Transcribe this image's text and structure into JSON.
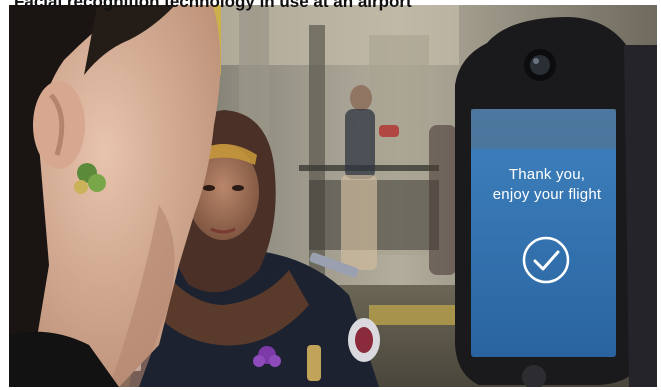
{
  "caption": {
    "text": "Facial recognition technology in use at an airport"
  },
  "kiosk": {
    "message_line1": "Thank you,",
    "message_line2": "enjoy your flight",
    "icon": "checkmark-circle-icon",
    "screen_color": "#2f6fa8"
  },
  "colors": {
    "uniform": "#1c2230",
    "kiosk_body": "#1a1a1c"
  }
}
